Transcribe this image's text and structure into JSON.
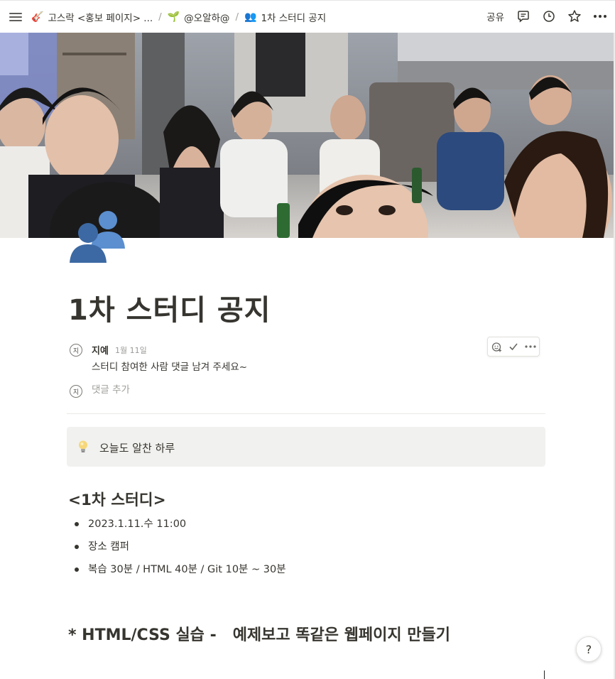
{
  "topbar": {
    "breadcrumbs": [
      {
        "icon": "guitar-icon",
        "glyph": "🎸",
        "label": "고스락 <홍보 페이지> ..."
      },
      {
        "icon": "seedling-icon",
        "glyph": "🌱",
        "label": "@오알하@"
      },
      {
        "icon": "people-icon",
        "glyph": "👥",
        "label": "1차 스터디 공지"
      }
    ],
    "separator": "/",
    "share_label": "공유"
  },
  "page": {
    "title": "1차 스터디 공지",
    "icon": "busts-in-silhouette-icon"
  },
  "comment": {
    "avatar_initial": "지",
    "author": "지예",
    "time": "1월 11일",
    "body": "스터디 참여한 사람 댓글 남겨 주세요~"
  },
  "add_comment": {
    "avatar_initial": "지",
    "placeholder": "댓글 추가"
  },
  "callout": {
    "icon": "lightbulb-icon",
    "text": "오늘도 알찬 하루"
  },
  "section1": {
    "heading": "<1차 스터디>",
    "items": [
      "2023.1.11.수 11:00",
      "장소 캠퍼",
      "복습 30분 /  HTML 40분 / Git 10분 ~ 30분"
    ]
  },
  "section2": {
    "heading": "* HTML/CSS 실습 -   예제보고 똑같은 웹페이지 만들기"
  },
  "help": {
    "label": "?"
  },
  "colors": {
    "text": "#37352f",
    "muted": "#9b9a97",
    "callout_bg": "#f1f1ef",
    "icon_blue": "#3f6fa5"
  }
}
